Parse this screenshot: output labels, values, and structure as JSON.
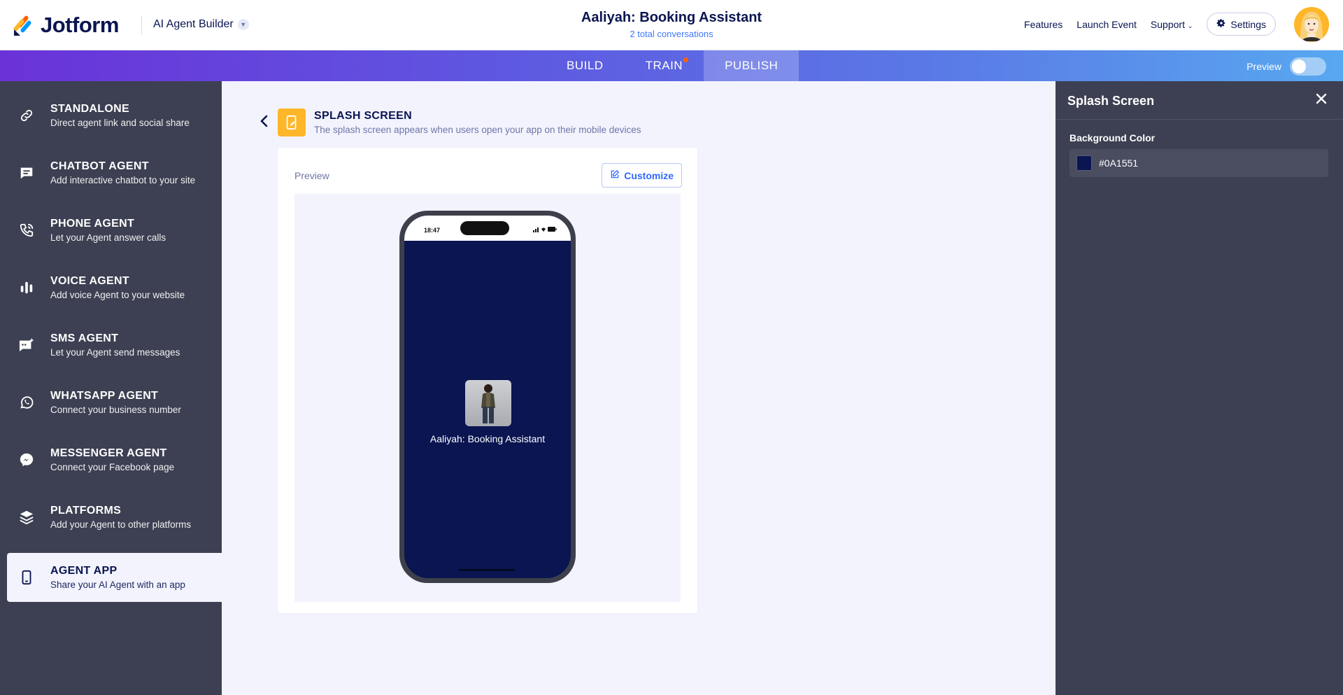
{
  "header": {
    "logo_text": "Jotform",
    "product_name": "AI Agent Builder",
    "title": "Aaliyah: Booking Assistant",
    "subtitle": "2 total conversations",
    "nav": {
      "features": "Features",
      "launch_event": "Launch Event",
      "support": "Support",
      "settings": "Settings"
    }
  },
  "tabs": {
    "build": "BUILD",
    "train": "TRAIN",
    "publish": "PUBLISH",
    "active": "PUBLISH",
    "preview_label": "Preview",
    "preview_on": false
  },
  "sidebar": {
    "items": [
      {
        "title": "STANDALONE",
        "desc": "Direct agent link and social share",
        "icon": "link-icon"
      },
      {
        "title": "CHATBOT AGENT",
        "desc": "Add interactive chatbot to your site",
        "icon": "chat-icon"
      },
      {
        "title": "PHONE AGENT",
        "desc": "Let your Agent answer calls",
        "icon": "phone-icon"
      },
      {
        "title": "VOICE AGENT",
        "desc": "Add voice Agent to your website",
        "icon": "voice-bars-icon"
      },
      {
        "title": "SMS AGENT",
        "desc": "Let your Agent send messages",
        "icon": "sms-icon"
      },
      {
        "title": "WHATSAPP AGENT",
        "desc": "Connect your business number",
        "icon": "whatsapp-icon"
      },
      {
        "title": "MESSENGER AGENT",
        "desc": "Connect your Facebook page",
        "icon": "messenger-icon"
      },
      {
        "title": "PLATFORMS",
        "desc": "Add your Agent to other platforms",
        "icon": "layers-icon"
      },
      {
        "title": "AGENT APP",
        "desc": "Share your AI Agent with an app",
        "icon": "mobile-icon"
      }
    ],
    "active_index": 8
  },
  "main": {
    "section_title": "SPLASH SCREEN",
    "section_desc": "The splash screen appears when users open your app on their mobile devices",
    "preview_label": "Preview",
    "customize_label": "Customize",
    "phone": {
      "time": "18:47",
      "app_name": "Aaliyah: Booking Assistant"
    }
  },
  "panel": {
    "title": "Splash Screen",
    "background_color_label": "Background Color",
    "background_color_value": "#0A1551"
  },
  "colors": {
    "accent": "#4277FF",
    "brand_navy": "#0A1551",
    "sidebar_bg": "#3D4052",
    "section_icon_bg": "#FFB629",
    "notification_dot": "#FF6100"
  }
}
